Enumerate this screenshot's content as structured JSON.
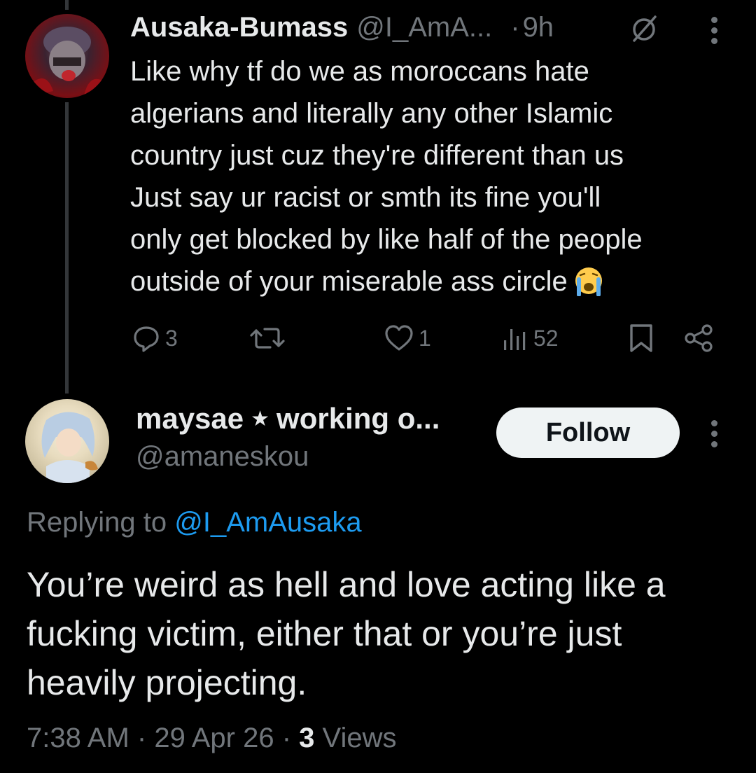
{
  "parent_tweet": {
    "display_name": "Ausaka-Bumass",
    "handle": "@I_AmA...",
    "separator": "·",
    "time": "9h",
    "text_lines": [
      "Like why tf do we as moroccans hate",
      "algerians and literally any other Islamic",
      "country just cuz they're different than us",
      "Just say ur racist or smth its fine you'll",
      "only get blocked by like half of the people",
      "outside of your miserable ass circle"
    ],
    "emoji": "loudly-crying-face",
    "actions": {
      "replies": "3",
      "likes": "1",
      "views": "52"
    }
  },
  "reply_tweet": {
    "display_name": "maysae",
    "separator_icon": "star",
    "name_suffix": "working o...",
    "handle": "@amaneskou",
    "follow_label": "Follow",
    "replying_to_label": "Replying to",
    "replying_to_handle": "@I_AmAusaka",
    "text_lines": [
      "You’re weird as hell and love acting like a",
      "fucking victim, either that or you’re just",
      "heavily projecting."
    ],
    "time": "7:38 AM",
    "date": "29 Apr 26",
    "views_count": "3",
    "views_label": "Views"
  },
  "colors": {
    "background": "#000000",
    "primary_text": "#e7e9ea",
    "secondary_text": "#71767b",
    "link": "#1d9bf0",
    "follow_bg": "#eff3f4"
  }
}
